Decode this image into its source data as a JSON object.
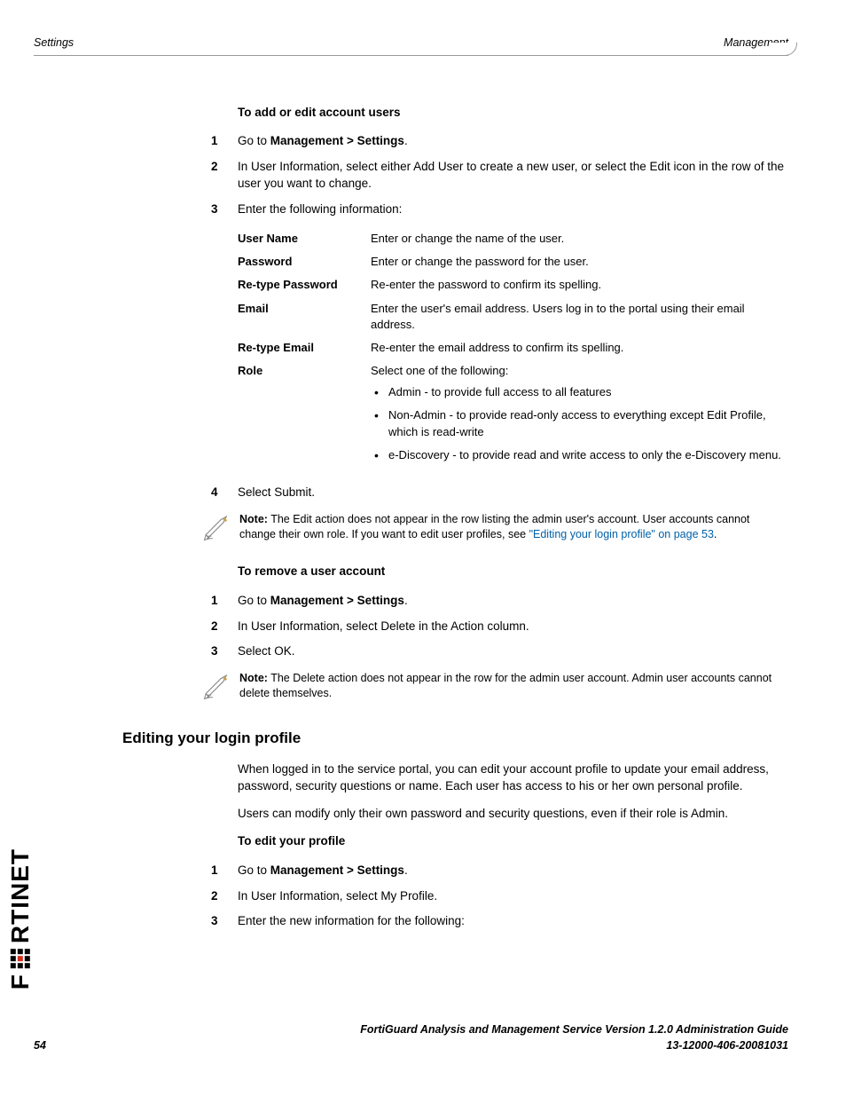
{
  "header": {
    "left": "Settings",
    "right": "Management"
  },
  "section1": {
    "title": "To add or edit account users",
    "steps": {
      "s1": {
        "num": "1",
        "pre": "Go to ",
        "bold": "Management > Settings",
        "post": "."
      },
      "s2": {
        "num": "2",
        "text": "In User Information, select either Add User to create a new user, or select the Edit icon in the row of the user you want to change."
      },
      "s3": {
        "num": "3",
        "text": "Enter the following information:"
      },
      "s4": {
        "num": "4",
        "text": "Select Submit."
      }
    },
    "fields": {
      "username": {
        "label": "User Name",
        "desc": "Enter or change the name of the user."
      },
      "password": {
        "label": "Password",
        "desc": "Enter or change the password for the user."
      },
      "retypepw": {
        "label": "Re-type Password",
        "desc": "Re-enter the password to confirm its spelling."
      },
      "email": {
        "label": "Email",
        "desc": "Enter the user's email address. Users log in to the portal using their email address."
      },
      "retypeemail": {
        "label": "Re-type Email",
        "desc": "Re-enter the email address to confirm its spelling."
      },
      "role": {
        "label": "Role",
        "desc": "Select one of the following:",
        "opts": {
          "a": "Admin - to provide full access to all features",
          "b": "Non-Admin - to provide read-only access to everything except Edit Profile, which is read-write",
          "c": "e-Discovery - to provide read and write access to only the e-Discovery menu."
        }
      }
    },
    "note": {
      "bold": "Note:",
      "text1": " The Edit action does not appear in the row listing the admin user's account. User accounts cannot change their own role. If you want to edit user profiles, see ",
      "link": "\"Editing your login profile\" on page 53",
      "text2": "."
    }
  },
  "section2": {
    "title": "To remove a user account",
    "steps": {
      "s1": {
        "num": "1",
        "pre": "Go to ",
        "bold": "Management > Settings",
        "post": "."
      },
      "s2": {
        "num": "2",
        "text": "In User Information, select Delete in the Action column."
      },
      "s3": {
        "num": "3",
        "text": "Select OK."
      }
    },
    "note": {
      "bold": "Note:",
      "text": " The Delete action does not appear in the row for the admin user account. Admin user accounts cannot delete themselves."
    }
  },
  "section3": {
    "heading": "Editing your login profile",
    "para1": "When logged in to the service portal, you can edit your account profile to update your email address, password, security questions or name. Each user has access to his or her own personal profile.",
    "para2": "Users can modify only their own password and security questions, even if their role is Admin.",
    "title": "To edit your profile",
    "steps": {
      "s1": {
        "num": "1",
        "pre": "Go to ",
        "bold": "Management > Settings",
        "post": "."
      },
      "s2": {
        "num": "2",
        "text": "In User Information, select My Profile."
      },
      "s3": {
        "num": "3",
        "text": "Enter the new information for the following:"
      }
    }
  },
  "footer": {
    "page": "54",
    "line1": "FortiGuard Analysis and Management Service Version 1.2.0 Administration Guide",
    "line2": "13-12000-406-20081031"
  },
  "logo": "F    RTINET"
}
